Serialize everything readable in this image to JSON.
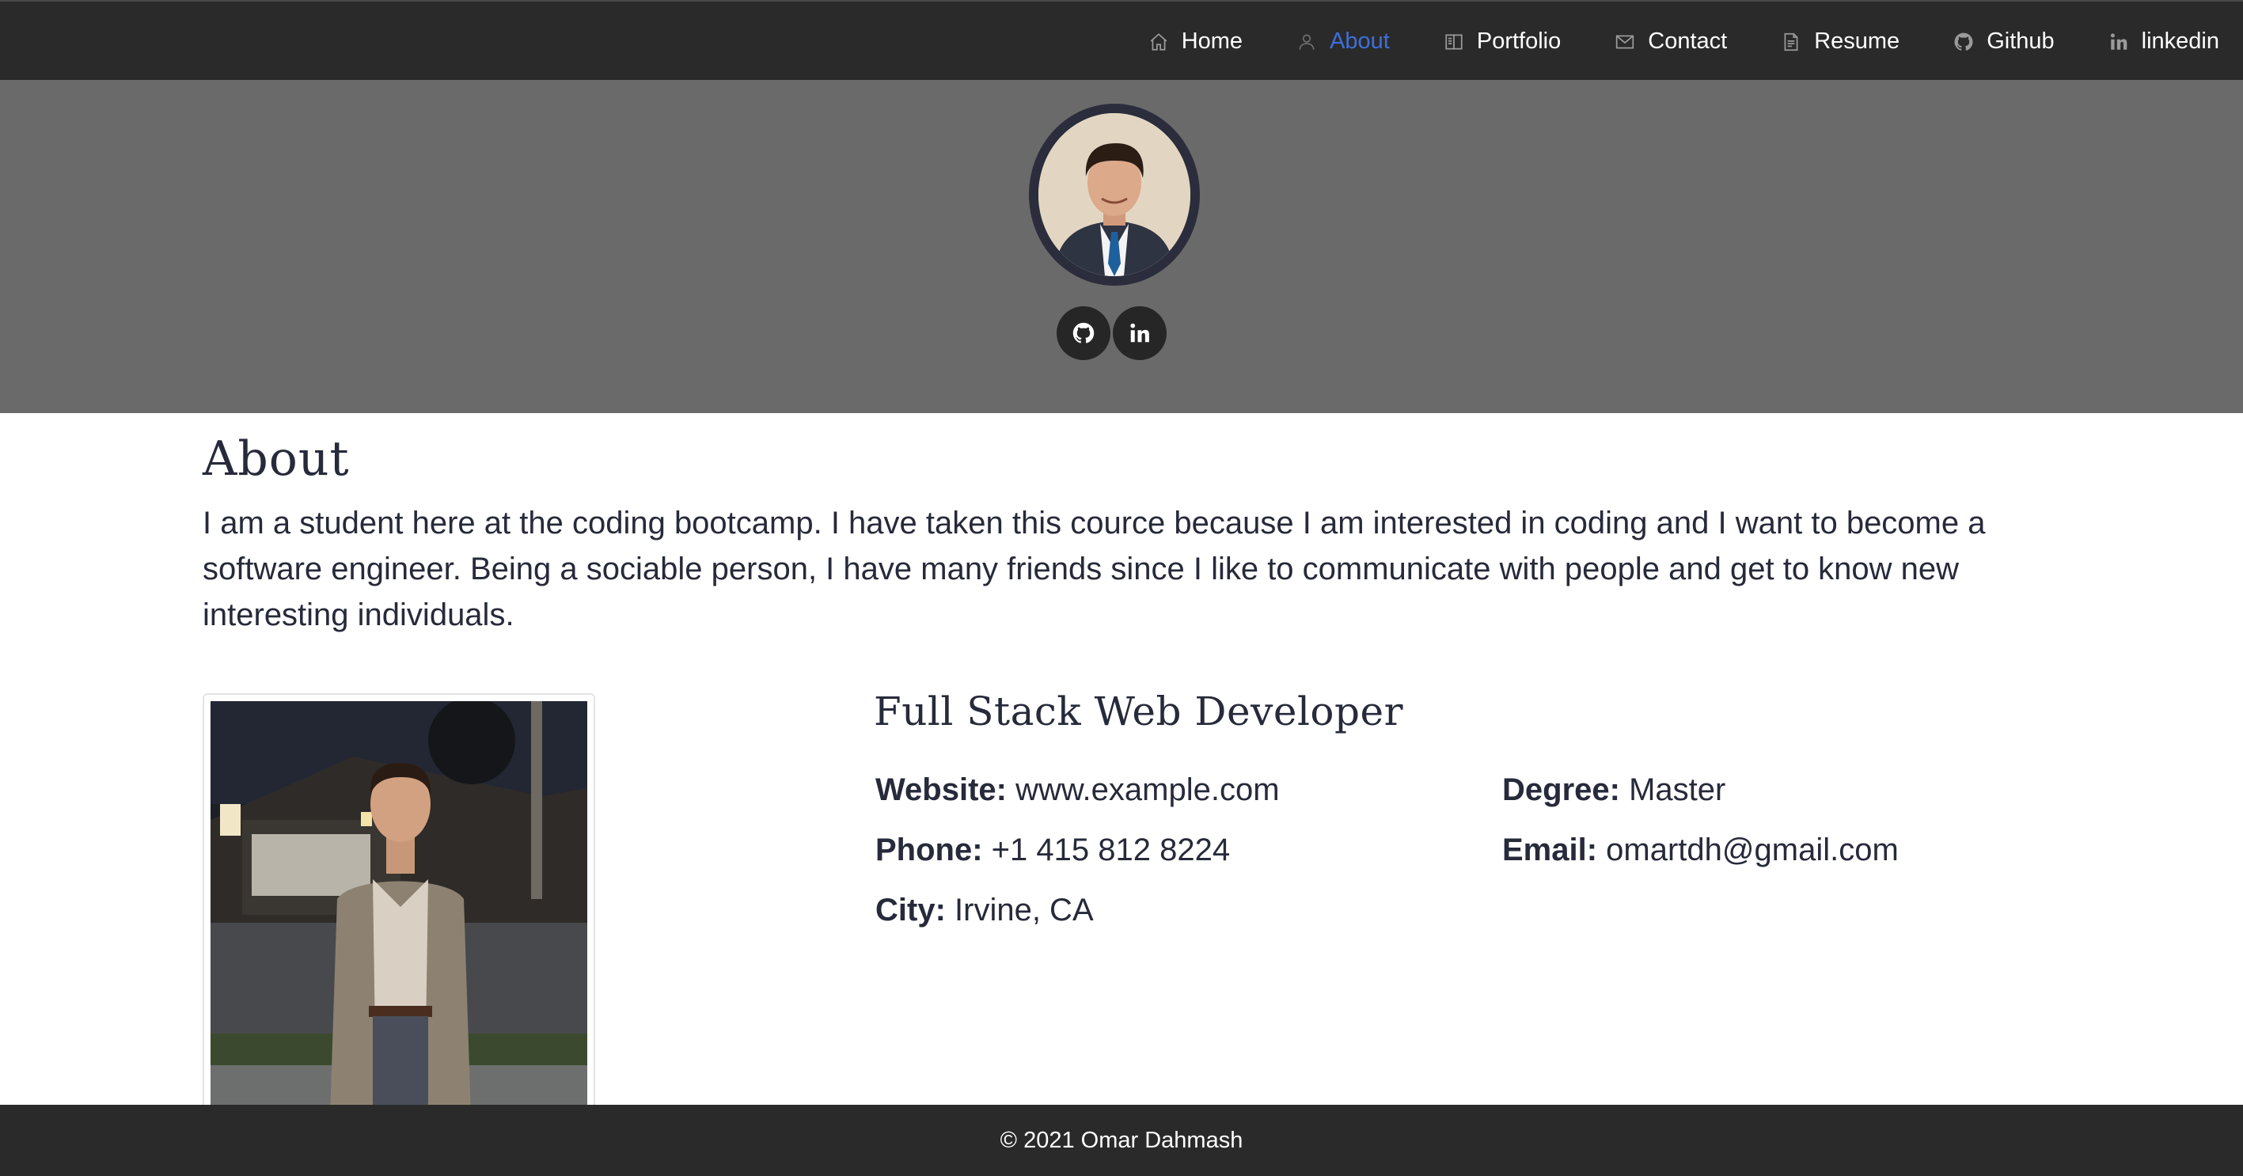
{
  "nav": {
    "items": [
      {
        "label": "Home",
        "icon": "home-icon"
      },
      {
        "label": "About",
        "icon": "person-icon",
        "active": true
      },
      {
        "label": "Portfolio",
        "icon": "book-icon"
      },
      {
        "label": "Contact",
        "icon": "envelope-icon"
      },
      {
        "label": "Resume",
        "icon": "file-icon"
      },
      {
        "label": "Github",
        "icon": "github-icon"
      },
      {
        "label": "linkedin",
        "icon": "linkedin-icon"
      }
    ]
  },
  "hero": {
    "social": [
      "github-icon",
      "linkedin-icon"
    ]
  },
  "about": {
    "title": "About",
    "text": "I am a student here at the coding bootcamp. I have taken this cource because I am interested in coding and I want to become a software engineer. Being a sociable person, I have many friends since I like to communicate with people and get to know new interesting individuals."
  },
  "profile": {
    "role": "Full Stack Web Developer",
    "website_label": "Website:",
    "website": "www.example.com",
    "phone_label": "Phone:",
    "phone": "+1 415 812 8224",
    "city_label": "City:",
    "city": "Irvine, CA",
    "degree_label": "Degree:",
    "degree": "Master",
    "email_label": "Email:",
    "email": "omartdh@gmail.com"
  },
  "footer": {
    "text": "© 2021 Omar Dahmash"
  },
  "colors": {
    "topbar": "#2a2a2a",
    "hero": "#6a6a6a",
    "active_link": "#3f6fd8",
    "text": "#262a3a"
  }
}
